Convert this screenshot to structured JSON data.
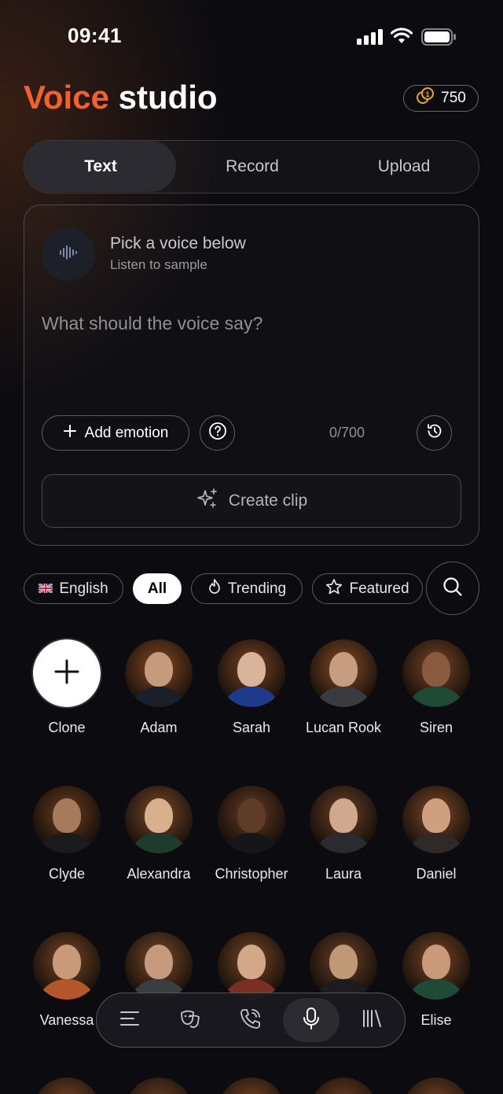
{
  "status": {
    "time": "09:41"
  },
  "header": {
    "title_accent": "Voice",
    "title_rest": "studio",
    "credits": "750"
  },
  "tabs": [
    {
      "label": "Text"
    },
    {
      "label": "Record"
    },
    {
      "label": "Upload"
    }
  ],
  "composer": {
    "voice_title": "Pick a voice below",
    "voice_subtitle": "Listen to sample",
    "prompt": "What should the voice say?",
    "add_emotion": "Add emotion",
    "counter": "0/700",
    "create": "Create clip"
  },
  "filters": {
    "language": "English",
    "all": "All",
    "trending": "Trending",
    "featured": "Featured"
  },
  "voices": [
    {
      "name": "Clone"
    },
    {
      "name": "Adam"
    },
    {
      "name": "Sarah"
    },
    {
      "name": "Lucan Rook"
    },
    {
      "name": "Siren"
    },
    {
      "name": "Clyde"
    },
    {
      "name": "Alexandra"
    },
    {
      "name": "Christopher"
    },
    {
      "name": "Laura"
    },
    {
      "name": "Daniel"
    },
    {
      "name": "Vanessa"
    },
    {
      "name": ""
    },
    {
      "name": ""
    },
    {
      "name": ""
    },
    {
      "name": "Elise"
    }
  ],
  "nav": [
    {
      "icon": "menu-icon"
    },
    {
      "icon": "masks-icon"
    },
    {
      "icon": "phone-call-icon"
    },
    {
      "icon": "microphone-icon"
    },
    {
      "icon": "library-icon"
    }
  ],
  "colors": {
    "accent": "#f3622c",
    "background": "#0b0b10"
  }
}
